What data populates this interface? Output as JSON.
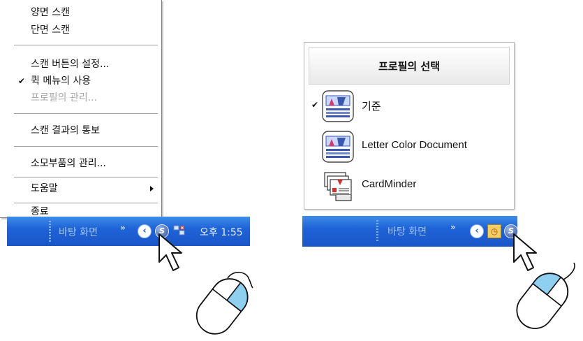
{
  "context_menu": {
    "items": [
      {
        "label": "양면 스캔",
        "checked": false,
        "disabled": false,
        "submenu": false
      },
      {
        "label": "단면 스캔",
        "checked": false,
        "disabled": false,
        "submenu": false
      },
      {
        "label": "스캔 버튼의 설정...",
        "checked": false,
        "disabled": false,
        "submenu": false
      },
      {
        "label": "퀵 메뉴의 사용",
        "checked": true,
        "disabled": false,
        "submenu": false
      },
      {
        "label": "프로필의 관리...",
        "checked": false,
        "disabled": true,
        "submenu": false
      },
      {
        "label": "스캔 결과의 통보",
        "checked": false,
        "disabled": false,
        "submenu": false
      },
      {
        "label": "소모부품의 관리...",
        "checked": false,
        "disabled": false,
        "submenu": false
      },
      {
        "label": "도움말",
        "checked": false,
        "disabled": false,
        "submenu": true
      },
      {
        "label": "종료",
        "checked": false,
        "disabled": false,
        "submenu": false
      }
    ],
    "check_glyph": "✔"
  },
  "taskbar_left": {
    "desktop_label": "바탕 화면",
    "chevron": "»",
    "expand_glyph": "‹",
    "tray_s_glyph": "S",
    "clock": "오후 1:55"
  },
  "taskbar_right": {
    "desktop_label": "바탕 화면",
    "chevron": "»",
    "expand_glyph": "‹",
    "clock_icon_glyph": "◷",
    "tray_s_glyph": "S"
  },
  "profile_popup": {
    "title": "프로필의 선택",
    "check_glyph": "✔",
    "profiles": [
      {
        "label": "기준",
        "selected": true,
        "icon": "scandall-organizer-icon"
      },
      {
        "label": "Letter Color Document",
        "selected": false,
        "icon": "scandall-organizer-icon"
      },
      {
        "label": "CardMinder",
        "selected": false,
        "icon": "cardminder-icon"
      }
    ]
  },
  "colors": {
    "taskbar": "#1f63d8",
    "mouse_button": "#8fd0f0"
  }
}
